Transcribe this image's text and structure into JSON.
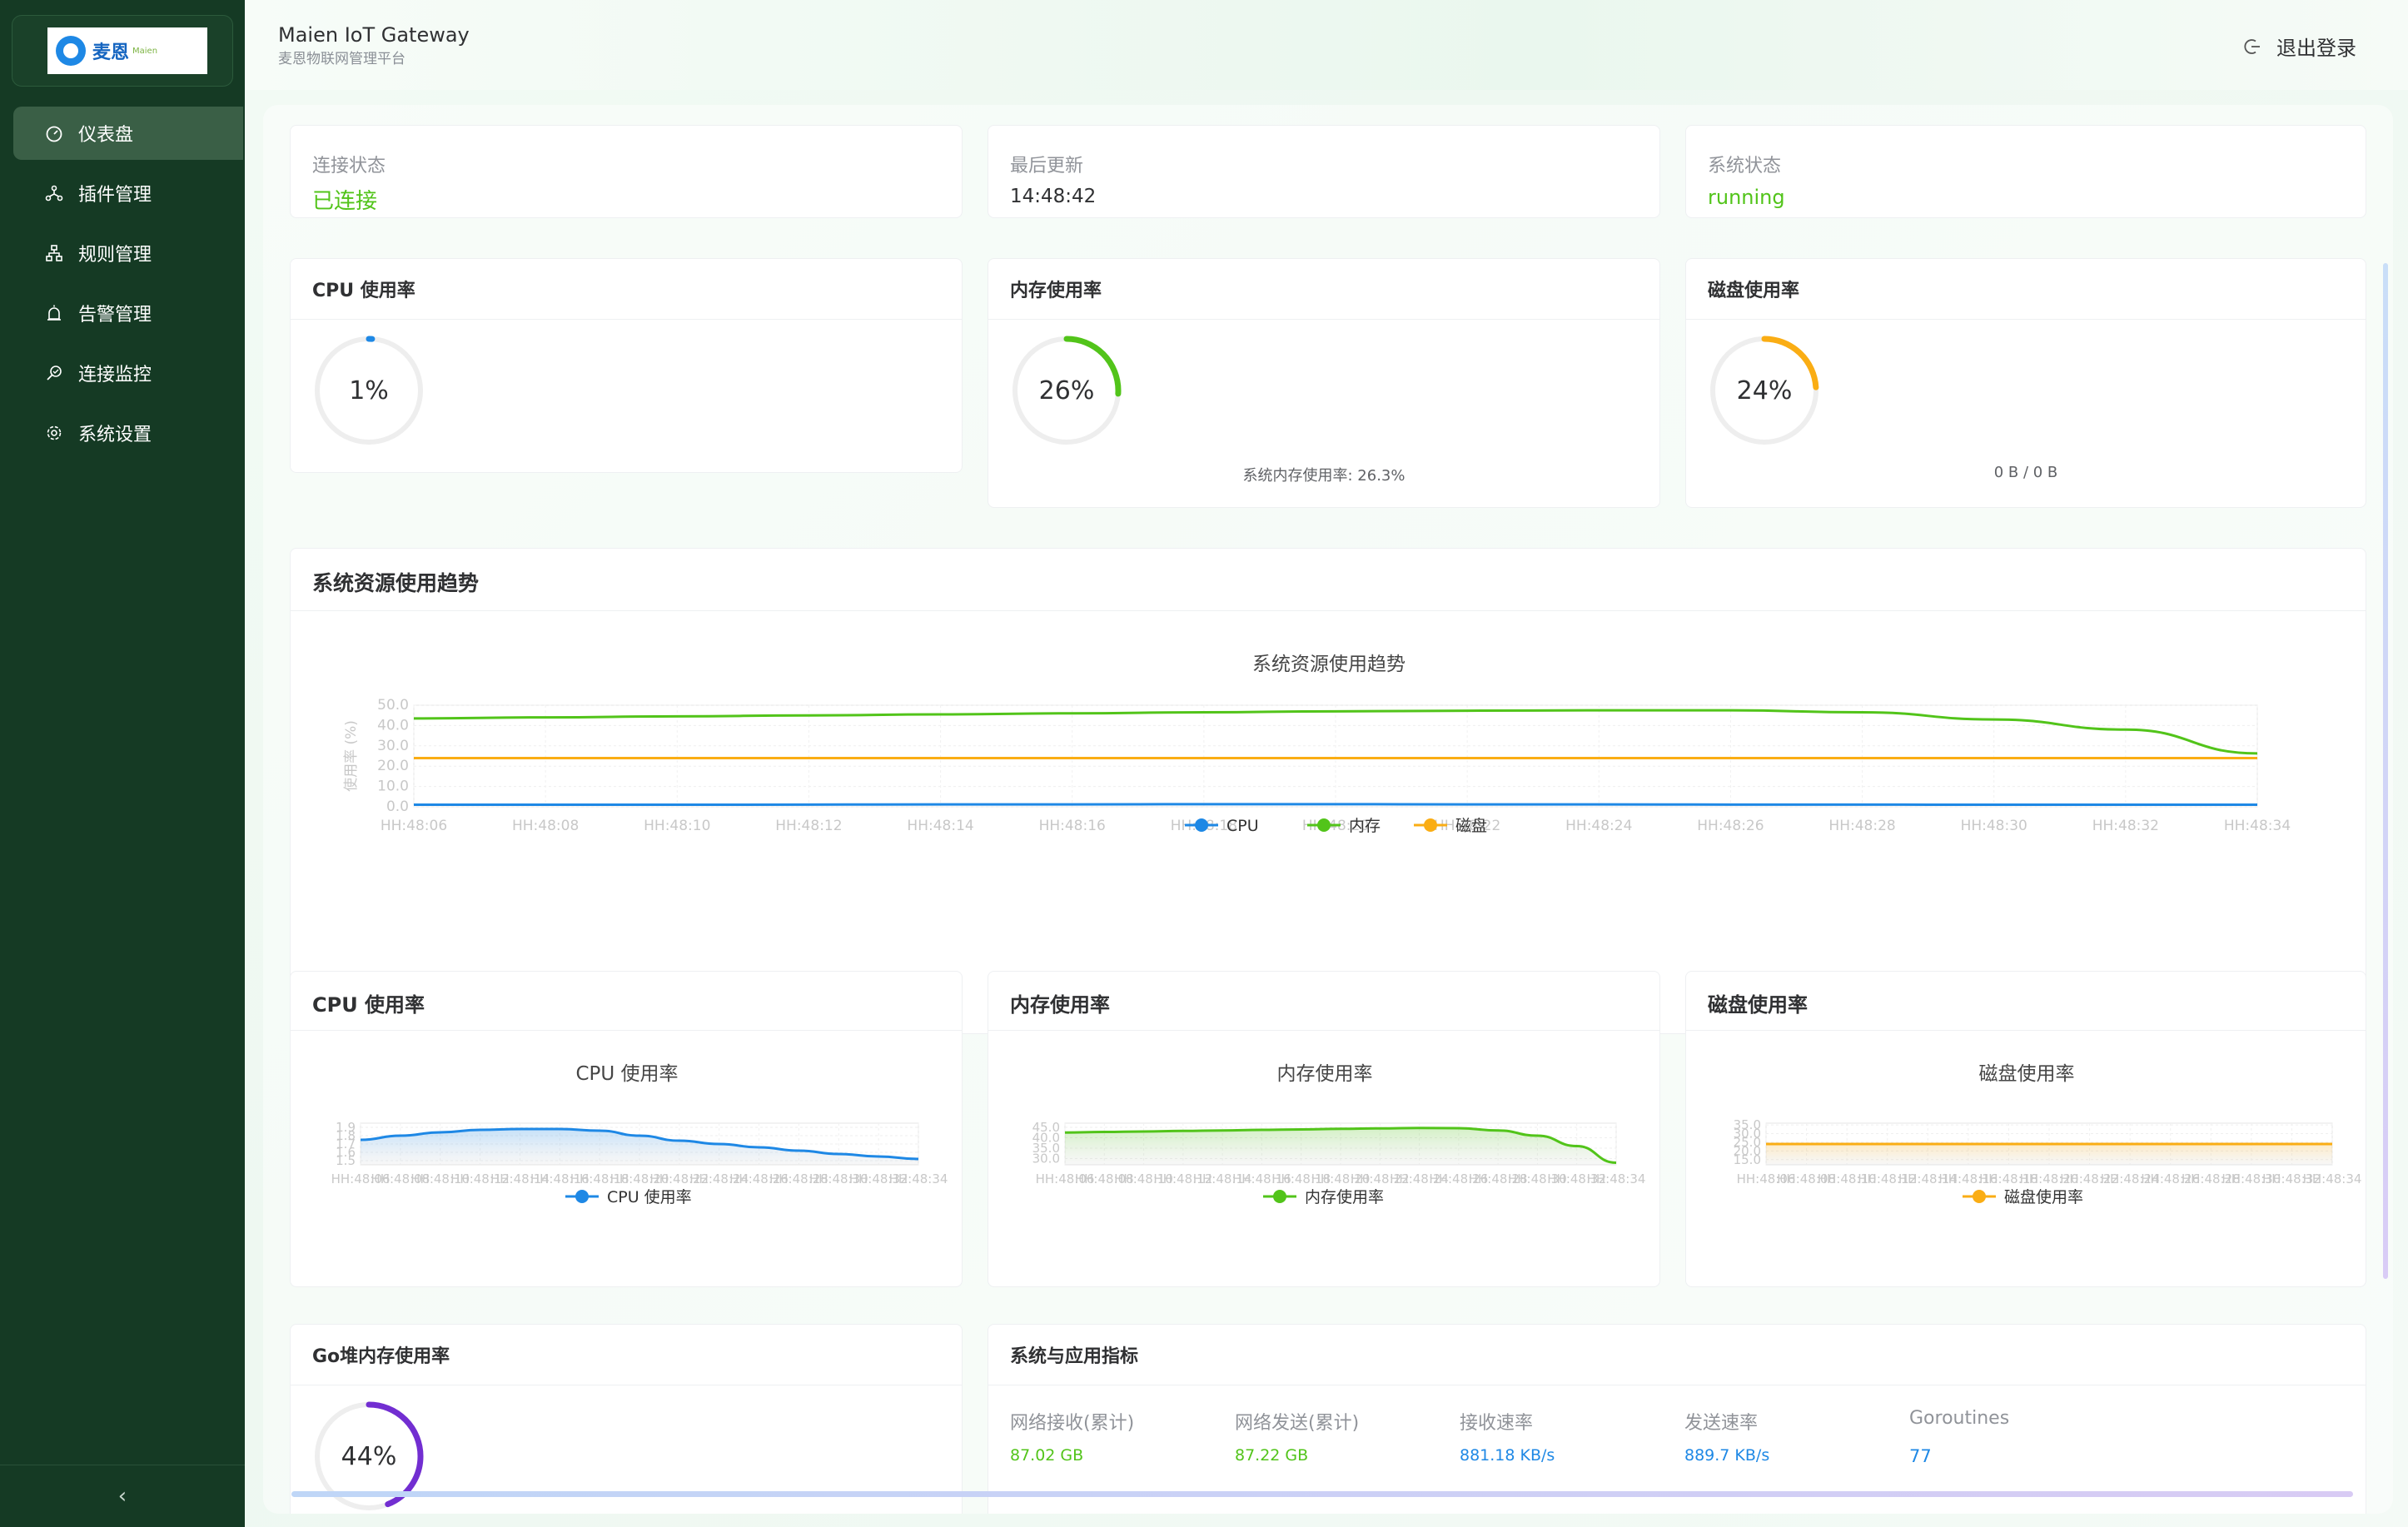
{
  "brand": {
    "logo_text": "麦恩",
    "logo_sub": "Maien"
  },
  "header": {
    "title": "Maien IoT Gateway",
    "subtitle": "麦恩物联网管理平台",
    "logout": "退出登录"
  },
  "sidebar": {
    "items": [
      {
        "label": "仪表盘",
        "icon": "dashboard-icon",
        "active": true
      },
      {
        "label": "插件管理",
        "icon": "plugin-icon"
      },
      {
        "label": "规则管理",
        "icon": "rules-icon"
      },
      {
        "label": "告警管理",
        "icon": "alarm-icon"
      },
      {
        "label": "连接监控",
        "icon": "monitor-icon"
      },
      {
        "label": "系统设置",
        "icon": "gear-icon"
      }
    ],
    "collapse": "‹"
  },
  "status": {
    "connection": {
      "label": "连接状态",
      "value": "已连接"
    },
    "last_update": {
      "label": "最后更新",
      "value": "14:48:42"
    },
    "system": {
      "label": "系统状态",
      "value": "running"
    }
  },
  "gauges": {
    "cpu": {
      "title": "CPU 使用率",
      "text": "1%",
      "percent": 1,
      "color": "#1e88e5"
    },
    "mem": {
      "title": "内存使用率",
      "text": "26%",
      "percent": 26,
      "color": "#52c41a",
      "note": "系统内存使用率: 26.3%"
    },
    "disk": {
      "title": "磁盘使用率",
      "text": "24%",
      "percent": 24,
      "color": "#faad14",
      "note": "0 B / 0 B"
    },
    "goheap": {
      "title": "Go堆内存使用率",
      "text": "44%",
      "percent": 44,
      "color": "#722ed1"
    }
  },
  "trend_card": {
    "title": "系统资源使用趋势"
  },
  "chart_data": [
    {
      "type": "line",
      "title": "系统资源使用趋势",
      "ylabel": "使用率 (%)",
      "ylim": [
        0,
        50
      ],
      "yticks": [
        "0.0",
        "10.0",
        "20.0",
        "30.0",
        "40.0",
        "50.0"
      ],
      "x": [
        "HH:48:06",
        "HH:48:08",
        "HH:48:10",
        "HH:48:12",
        "HH:48:14",
        "HH:48:16",
        "HH:48:18",
        "HH:48:20",
        "HH:48:22",
        "HH:48:24",
        "HH:48:26",
        "HH:48:28",
        "HH:48:30",
        "HH:48:32",
        "HH:48:34"
      ],
      "series": [
        {
          "name": "CPU",
          "color": "#1e88e5",
          "values": [
            1,
            1,
            1,
            1.1,
            1.2,
            1.2,
            1.3,
            1.3,
            1.2,
            1.2,
            1.1,
            1.1,
            1.0,
            1.0,
            1.0
          ]
        },
        {
          "name": "内存",
          "color": "#52c41a",
          "values": [
            43.5,
            44,
            44.5,
            45,
            45.5,
            46,
            46.5,
            47,
            47.3,
            47.5,
            47.5,
            46.5,
            43,
            38,
            26.3
          ]
        },
        {
          "name": "磁盘",
          "color": "#faad14",
          "values": [
            24,
            24,
            24,
            24,
            24,
            24,
            24,
            24,
            24,
            24,
            24,
            24,
            24,
            24,
            24
          ]
        }
      ],
      "legend": "bottom"
    },
    {
      "type": "area",
      "card_title": "CPU 使用率",
      "title": "CPU 使用率",
      "yticks": [
        "1.5",
        "1.6",
        "1.7",
        "1.8",
        "1.9"
      ],
      "ylim": [
        1.45,
        1.95
      ],
      "x": [
        "HH:48:06",
        "HH:48:08",
        "HH:48:10",
        "HH:48:12",
        "HH:48:14",
        "HH:48:16",
        "HH:48:18",
        "HH:48:20",
        "HH:48:22",
        "HH:48:24",
        "HH:48:26",
        "HH:48:28",
        "HH:48:30",
        "HH:48:32",
        "HH:48:34"
      ],
      "series": [
        {
          "name": "CPU 使用率",
          "color": "#1e88e5",
          "values": [
            1.75,
            1.8,
            1.84,
            1.87,
            1.88,
            1.88,
            1.86,
            1.8,
            1.74,
            1.7,
            1.66,
            1.62,
            1.58,
            1.55,
            1.52
          ]
        }
      ],
      "legend": "bottom"
    },
    {
      "type": "area",
      "card_title": "内存使用率",
      "title": "内存使用率",
      "yticks": [
        "30.0",
        "35.0",
        "40.0",
        "45.0"
      ],
      "ylim": [
        27,
        47
      ],
      "x": [
        "HH:48:06",
        "HH:48:08",
        "HH:48:10",
        "HH:48:12",
        "HH:48:14",
        "HH:48:16",
        "HH:48:18",
        "HH:48:20",
        "HH:48:22",
        "HH:48:24",
        "HH:48:26",
        "HH:48:28",
        "HH:48:30",
        "HH:48:32",
        "HH:48:34"
      ],
      "series": [
        {
          "name": "内存使用率",
          "color": "#52c41a",
          "values": [
            42.5,
            42.8,
            43,
            43.3,
            43.5,
            43.8,
            44,
            44.3,
            44.5,
            44.7,
            44.6,
            43.5,
            41,
            36,
            28
          ]
        }
      ],
      "legend": "bottom"
    },
    {
      "type": "area",
      "card_title": "磁盘使用率",
      "title": "磁盘使用率",
      "yticks": [
        "15.0",
        "20.0",
        "25.0",
        "30.0",
        "35.0"
      ],
      "ylim": [
        12,
        36
      ],
      "x": [
        "HH:48:06",
        "HH:48:08",
        "HH:48:10",
        "HH:48:12",
        "HH:48:14",
        "HH:48:16",
        "HH:48:18",
        "HH:48:20",
        "HH:48:22",
        "HH:48:24",
        "HH:48:26",
        "HH:48:28",
        "HH:48:30",
        "HH:48:32",
        "HH:48:34"
      ],
      "series": [
        {
          "name": "磁盘使用率",
          "color": "#faad14",
          "values": [
            24,
            24,
            24,
            24,
            24,
            24,
            24,
            24,
            24,
            24,
            24,
            24,
            24,
            24,
            24
          ]
        }
      ],
      "legend": "bottom"
    }
  ],
  "metrics": {
    "title": "系统与应用指标",
    "items": [
      {
        "label": "网络接收(累计)",
        "value": "87.02 GB",
        "color": "#52c41a"
      },
      {
        "label": "网络发送(累计)",
        "value": "87.22 GB",
        "color": "#52c41a"
      },
      {
        "label": "接收速率",
        "value": "881.18 KB/s",
        "color": "#1e88e5"
      },
      {
        "label": "发送速率",
        "value": "889.7 KB/s",
        "color": "#1e88e5"
      },
      {
        "label": "Goroutines",
        "value": "77",
        "color": "#1e88e5"
      }
    ]
  }
}
